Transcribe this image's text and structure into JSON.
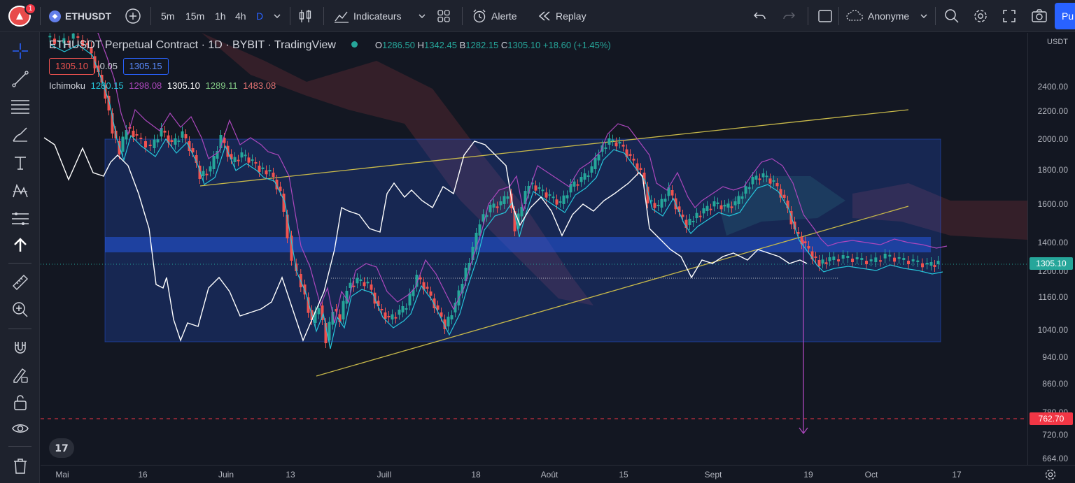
{
  "toolbar": {
    "notification_count": "1",
    "symbol": "ETHUSDT",
    "intervals": [
      "5m",
      "15m",
      "1h",
      "4h",
      "D"
    ],
    "indicators_label": "Indicateurs",
    "alert_label": "Alerte",
    "replay_label": "Replay",
    "layout_name": "Anonyme",
    "publish_label": "Pu"
  },
  "legend": {
    "title": "ETHUSDT Perpetual Contract · 1D · BYBIT · TradingView",
    "o_label": "O",
    "o": "1286.50",
    "h_label": "H",
    "h": "1342.45",
    "b_label": "B",
    "b": "1282.15",
    "c_label": "C",
    "c": "1305.10",
    "change": "+18.60 (+1.45%)",
    "bid": "1305.10",
    "spread": "0.05",
    "ask": "1305.15",
    "indicator_name": "Ichimoku",
    "ichimoku_values": [
      "1280.15",
      "1298.08",
      "1305.10",
      "1289.11",
      "1483.08"
    ]
  },
  "price_axis": {
    "currency": "USDT",
    "labels": [
      "2400.00",
      "2200.00",
      "2000.00",
      "1800.00",
      "1600.00",
      "1400.00",
      "1200.00",
      "1160.00",
      "1040.00",
      "940.00",
      "860.00",
      "780.00",
      "720.00",
      "664.00"
    ],
    "last_price": "1305.10",
    "target_price": "762.70"
  },
  "time_axis": {
    "labels": [
      "Mai",
      "16",
      "Juin",
      "13",
      "Juill",
      "18",
      "Août",
      "15",
      "Sept",
      "19",
      "Oct",
      "17"
    ]
  },
  "colors": {
    "background": "#131722",
    "bull": "#26a69a",
    "bear": "#ef5350",
    "zone": "#2962ff",
    "trendline": "#c8b94a",
    "kijun": "#ab47bc",
    "tenkan": "#26c6da",
    "overlay": "#ffffff"
  },
  "icons": [
    "crosshair-icon",
    "trendline-icon",
    "fib-icon",
    "brush-icon",
    "text-icon",
    "pattern-icon",
    "forecast-icon",
    "arrow-up-icon",
    "ruler-icon",
    "zoom-in-icon",
    "magnet-icon",
    "lock-drawing-icon",
    "lock-icon",
    "eye-icon",
    "trash-icon"
  ]
}
